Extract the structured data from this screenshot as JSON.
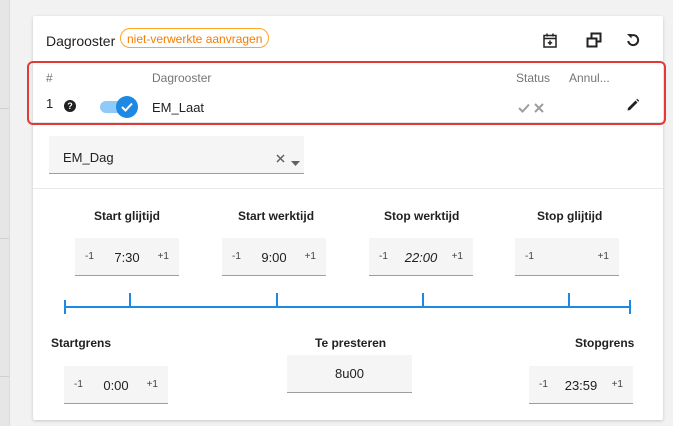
{
  "header": {
    "title": "Dagrooster",
    "badge": "niet-verwerkte aanvragen",
    "icons": [
      "calendar-add-icon",
      "duplicate-icon",
      "refresh-icon"
    ]
  },
  "table": {
    "columns": {
      "num": "#",
      "schedule": "Dagrooster",
      "status": "Status",
      "cancel": "Annul..."
    },
    "rows": [
      {
        "num": "1",
        "help_icon": "question-icon",
        "toggle_on": true,
        "name": "EM_Laat",
        "status_icons": [
          "check-icon",
          "cross-icon"
        ],
        "edit_icon": "pencil-icon"
      }
    ]
  },
  "select": {
    "value": "EM_Dag"
  },
  "times": {
    "start_glijtijd": {
      "label": "Start glijtijd",
      "value": "7:30"
    },
    "start_werktijd": {
      "label": "Start werktijd",
      "value": "9:00"
    },
    "stop_werktijd": {
      "label": "Stop werktijd",
      "value": "22:00"
    },
    "stop_glijtijd": {
      "label": "Stop glijtijd",
      "value": ""
    },
    "startgrens": {
      "label": "Startgrens",
      "value": "0:00"
    },
    "te_presteren": {
      "label": "Te presteren",
      "value": "8u00"
    },
    "stopgrens": {
      "label": "Stopgrens",
      "value": "23:59"
    }
  },
  "stepper": {
    "minus": "-1",
    "plus": "+1"
  },
  "colors": {
    "accent": "#1e88e5",
    "badge": "#f57c00",
    "highlight": "#e53935"
  }
}
